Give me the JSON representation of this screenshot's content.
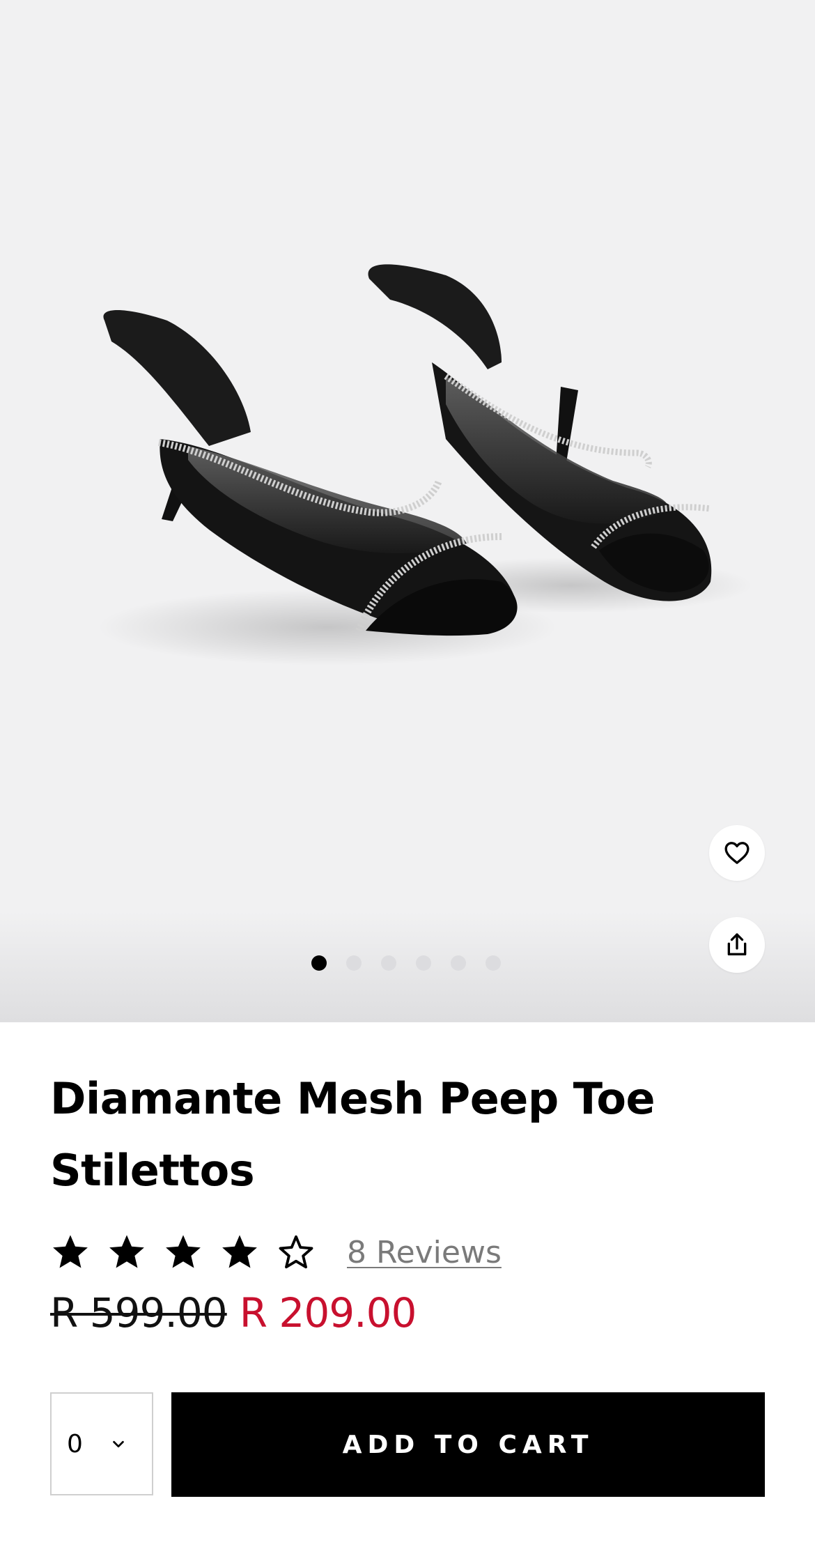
{
  "gallery": {
    "image_description_icon": "black-mesh-diamante-mule-icon",
    "active_index": 0,
    "total_images": 6
  },
  "actions": {
    "wishlist_icon": "heart-icon",
    "share_icon": "share-icon"
  },
  "product": {
    "title": "Diamante Mesh Peep Toe Stilettos",
    "rating": 4,
    "rating_max": 5,
    "reviews_label": "8 Reviews",
    "old_price": "R 599.00",
    "sale_price": "R 209.00",
    "sale_color": "#c8102e"
  },
  "buy": {
    "quantity": "0",
    "add_to_cart_label": "ADD TO CART"
  }
}
